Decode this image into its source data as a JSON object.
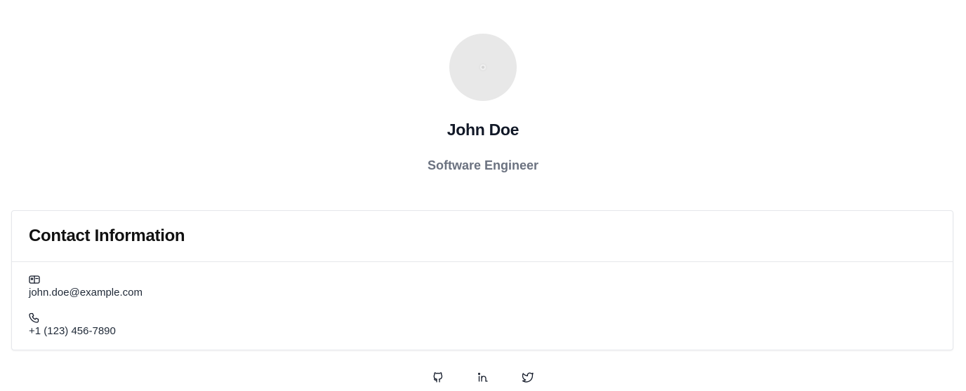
{
  "profile": {
    "name": "John Doe",
    "title": "Software Engineer"
  },
  "contact": {
    "heading": "Contact Information",
    "email": "john.doe@example.com",
    "phone": "+1 (123) 456-7890"
  },
  "icons": {
    "avatar": "avatar-placeholder-icon",
    "email": "id-card-icon",
    "phone": "phone-icon",
    "social": [
      "github-icon",
      "linkedin-icon",
      "twitter-icon"
    ]
  },
  "colors": {
    "name": "#111827",
    "subtitle": "#6b7280",
    "border": "#e5e7eb",
    "avatar_bg": "#e8e8e8"
  }
}
